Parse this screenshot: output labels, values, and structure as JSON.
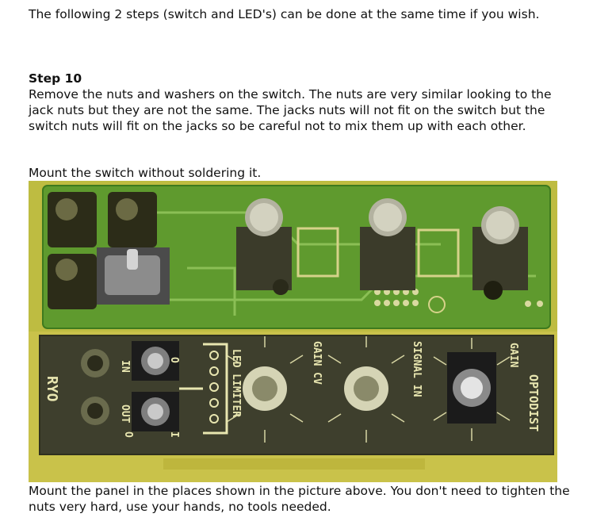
{
  "intro": "The following 2 steps (switch and LED's) can be done at the same time if you wish.",
  "step": {
    "heading": "Step 10",
    "body": "Remove the nuts and washers on the switch. The nuts are very similar looking to the jack nuts but they are not the same. The jacks nuts will not fit on the switch but the switch nuts will fit on the jacks so be careful not to mix them up with each other."
  },
  "mount_switch": "Mount the switch without soldering it.",
  "photo": {
    "panel_labels": {
      "in": "IN",
      "out": "OUT",
      "led_limiter": "LED LIMITER",
      "gain_cv": "GAIN CV",
      "signal_in": "SIGNAL IN",
      "gain": "GAIN",
      "optodist": "OPTODIST",
      "logo": "RYO",
      "switch_i": "I",
      "switch_o": "O",
      "switch_o2": "O"
    }
  },
  "mount_panel": "Mount the panel in the places shown in the picture above. You don't need to tighten the nuts very hard, use your hands, no tools needed."
}
